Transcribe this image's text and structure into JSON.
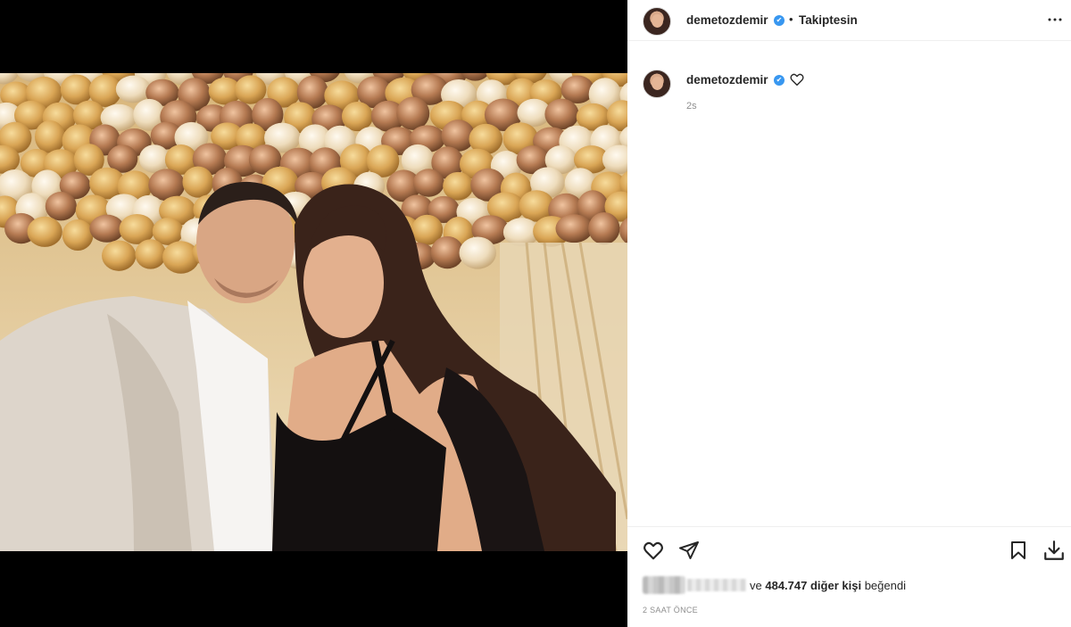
{
  "post": {
    "author": "demetozdemir",
    "follow_status": "Takiptesin",
    "separator": "•",
    "verified_mark": "✔",
    "more_icon": "more-horizontal-icon"
  },
  "caption": {
    "author": "demetozdemir",
    "time_ago": "2s",
    "like_icon": "heart-outline-icon"
  },
  "actions": {
    "like_icon": "heart-outline-icon",
    "share_icon": "paper-plane-icon",
    "save_icon": "bookmark-icon",
    "download_icon": "download-icon"
  },
  "likes": {
    "prefix": "ve",
    "count": "484.747",
    "suffix_bold": "diğer kişi",
    "suffix": "beğendi"
  },
  "date": "2 SAAT ÖNCE",
  "colors": {
    "verified": "#3897f0",
    "text": "#262626",
    "muted": "#8e8e8e",
    "media_bg": "#000000"
  }
}
